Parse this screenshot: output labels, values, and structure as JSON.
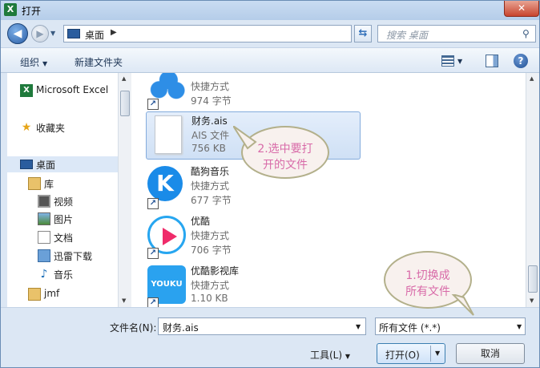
{
  "window": {
    "title": "打开",
    "close_label": "✕"
  },
  "nav": {
    "address": "桌面",
    "search_placeholder": "搜索 桌面"
  },
  "toolbar": {
    "organize": "组织",
    "new_folder": "新建文件夹"
  },
  "sidebar": {
    "items": [
      {
        "label": "Microsoft Excel",
        "icon": "excel-icon"
      },
      {
        "label": "收藏夹",
        "icon": "star-icon"
      },
      {
        "label": "桌面",
        "icon": "desktop-icon"
      },
      {
        "label": "库",
        "icon": "library-icon"
      },
      {
        "label": "视频",
        "icon": "video-icon"
      },
      {
        "label": "图片",
        "icon": "picture-icon"
      },
      {
        "label": "文档",
        "icon": "document-icon"
      },
      {
        "label": "迅雷下载",
        "icon": "download-icon"
      },
      {
        "label": "音乐",
        "icon": "music-icon"
      },
      {
        "label": "jmf",
        "icon": "user-folder-icon"
      }
    ]
  },
  "files": [
    {
      "name": "",
      "type": "快捷方式",
      "size": "974 字节",
      "icon": "baidu-cloud-icon"
    },
    {
      "name": "财务.ais",
      "type": "AIS 文件",
      "size": "756 KB",
      "icon": "document-icon"
    },
    {
      "name": "酷狗音乐",
      "type": "快捷方式",
      "size": "677 字节",
      "icon": "kugou-icon"
    },
    {
      "name": "优酷",
      "type": "快捷方式",
      "size": "706 字节",
      "icon": "youku-icon"
    },
    {
      "name": "优酷影视库",
      "type": "快捷方式",
      "size": "1.10 KB",
      "icon": "youku-tv-icon"
    }
  ],
  "bottom": {
    "filename_label": "文件名(N):",
    "filename_value": "财务.ais",
    "filetype_value": "所有文件 (*.*)",
    "tools_label": "工具(L)",
    "open_label": "打开(O)",
    "cancel_label": "取消"
  },
  "annotations": {
    "callout1_line1": "2.选中要打",
    "callout1_line2": "开的文件",
    "callout2_line1": "1.切换成",
    "callout2_line2": "所有文件"
  },
  "colors": {
    "callout_text": "#d86aa8",
    "selection": "#cfe0f5",
    "close_button": "#c8442e"
  }
}
